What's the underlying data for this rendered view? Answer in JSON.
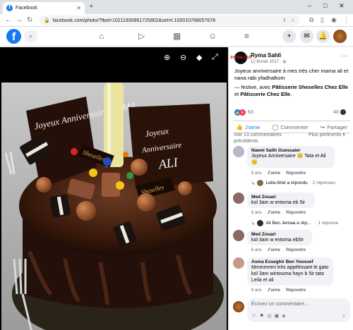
{
  "browser": {
    "tab_title": "Facebook",
    "new_tab": "+",
    "url": "facebook.com/photo/?fbid=10211930861725802&set=t.100010768057678",
    "min": "–",
    "max": "□",
    "close": "✕"
  },
  "post": {
    "author": "Ryma Sahli",
    "date": "12 février 2017 · ",
    "caption_line1": "Joyeux anniversaire à mes très cher mama ali et nana rabi yfadhalkom",
    "caption_prefix": "— festive, avec ",
    "tag1": "Pâtisserie Sheselles Chez Elle",
    "caption_and": " et ",
    "tag2": "Pâtisserie Chez Elle",
    "caption_end": ".",
    "reactions_count": "63",
    "comments_count": "40",
    "like_label": "J'aime",
    "comment_label": "Commenter",
    "share_label": "Partager",
    "view_more": "Voir 13 commentaires précédents",
    "sort": "Plus pertinents ▾",
    "author_avatar_text": "SHESELLES"
  },
  "comments": [
    {
      "name": "Nawel Salih Guessaier",
      "text": "Joyeux Anniversaire 😊 Tata et Ali 😊",
      "time": "6 ans",
      "like": "J'aime",
      "reply": "Répondre",
      "replies_user": "Leila Abid a répondu",
      "replies_count": "· 2 réponses"
    },
    {
      "name": "Med Zouari",
      "text": "kol 3am w entoma eb 5ir",
      "time": "6 ans",
      "like": "J'aime",
      "reply": "Répondre",
      "replies_user": "Ali Ben Jemaa a rép...",
      "replies_count": "· 1 réponse"
    },
    {
      "name": "Med Zouari",
      "text": "kol 3am w entoma eb5ir",
      "time": "6 ans",
      "like": "J'aime",
      "reply": "Répondre"
    },
    {
      "name": "Asma Esseghir Ben Youssef",
      "text": "Mmmmmm très appétissant le gato kol 3am wintouma hayn b 5ir tata Leila et ali",
      "time": "6 ans",
      "like": "J'aime",
      "reply": "Répondre"
    }
  ],
  "composer": {
    "placeholder": "Écrivez un commentaire…"
  },
  "cake": {
    "topper_left": "Joyeux Anniversaire MAMA",
    "topper_right_1": "Joyeux",
    "topper_right_2": "Anniversaire",
    "topper_right_3": "ALI",
    "brand": "Sheselles"
  }
}
